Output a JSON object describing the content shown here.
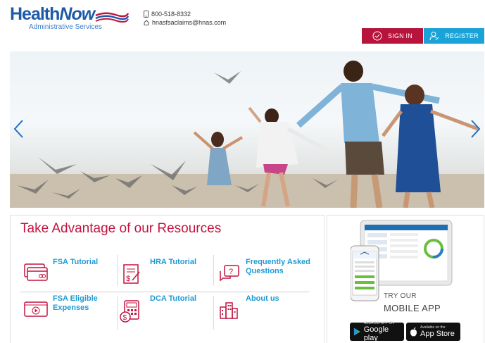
{
  "header": {
    "logo_main_part1": "Health",
    "logo_main_part2": "Now",
    "logo_sub": "Administrative Services",
    "phone": "800-518-8332",
    "email": "hnasfsaclaims@hnas.com",
    "phone_icon": "phone-icon",
    "email_icon": "home-mail-icon",
    "signin_label": "SIGN IN",
    "register_label": "REGISTER"
  },
  "colors": {
    "brand_blue": "#1e5aa8",
    "brand_red": "#b8133b",
    "register_blue": "#1aa3d9",
    "link_blue": "#1e9ad6"
  },
  "hero": {
    "prev_icon": "chevron-left-icon",
    "next_icon": "chevron-right-icon"
  },
  "resources": {
    "title_part1": "Take ",
    "title_part2": "Advantage",
    "title_part3": " of our Resources",
    "items": [
      {
        "label": "FSA Tutorial",
        "icon": "credit-card-icon"
      },
      {
        "label": "HRA Tutorial",
        "icon": "dollar-document-icon"
      },
      {
        "label": "Frequently Asked Questions",
        "icon": "question-chat-icon"
      },
      {
        "label": "FSA Eligible Expenses",
        "icon": "video-play-icon"
      },
      {
        "label": "DCA Tutorial",
        "icon": "calculator-dollar-icon"
      },
      {
        "label": "About us",
        "icon": "buildings-icon"
      }
    ]
  },
  "app": {
    "try_label": "TRY OUR",
    "mobile_label": "MOBILE APP",
    "google_small": "ANDROID APP ON",
    "google_big": "Google play",
    "apple_small": "Available on the",
    "apple_big": "App Store"
  }
}
